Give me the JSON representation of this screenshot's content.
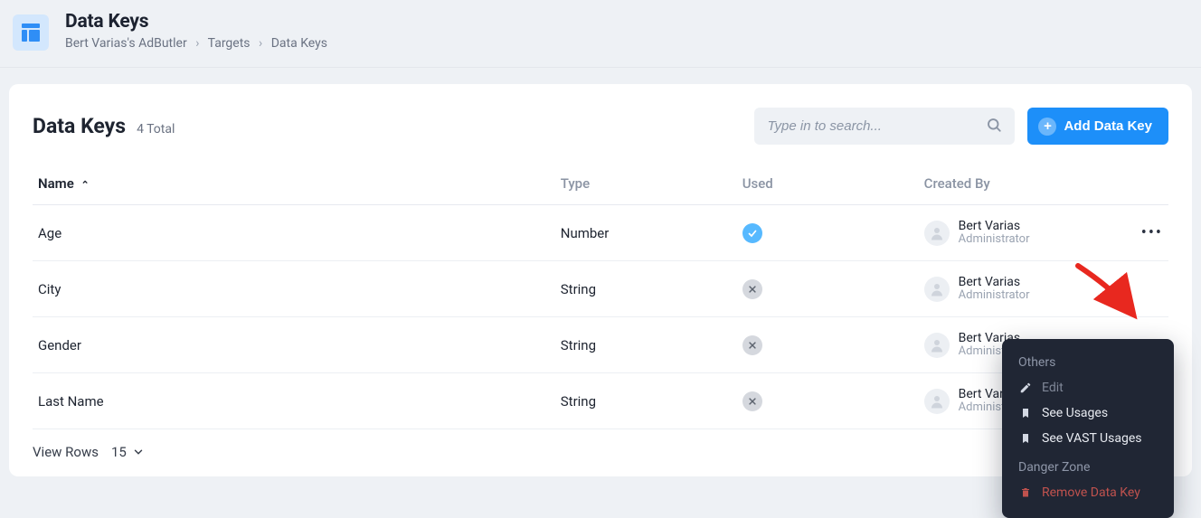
{
  "header": {
    "title": "Data Keys",
    "breadcrumb": [
      "Bert Varias's AdButler",
      "Targets",
      "Data Keys"
    ]
  },
  "panel": {
    "title": "Data Keys",
    "count_text": "4 Total",
    "search_placeholder": "Type in to search...",
    "add_button_label": "Add Data Key"
  },
  "columns": {
    "name": "Name",
    "type": "Type",
    "used": "Used",
    "created_by": "Created By"
  },
  "rows": [
    {
      "name": "Age",
      "type": "Number",
      "used": true,
      "creator_name": "Bert Varias",
      "creator_role": "Administrator"
    },
    {
      "name": "City",
      "type": "String",
      "used": false,
      "creator_name": "Bert Varias",
      "creator_role": "Administrator"
    },
    {
      "name": "Gender",
      "type": "String",
      "used": false,
      "creator_name": "Bert Varias",
      "creator_role": "Administrator"
    },
    {
      "name": "Last Name",
      "type": "String",
      "used": false,
      "creator_name": "Bert Varias",
      "creator_role": "Administrator"
    }
  ],
  "footer": {
    "view_rows_label": "View Rows",
    "page_size": "15"
  },
  "context_menu": {
    "section_others": "Others",
    "edit": "Edit",
    "see_usages": "See Usages",
    "see_vast_usages": "See VAST Usages",
    "section_danger": "Danger Zone",
    "remove": "Remove Data Key"
  }
}
